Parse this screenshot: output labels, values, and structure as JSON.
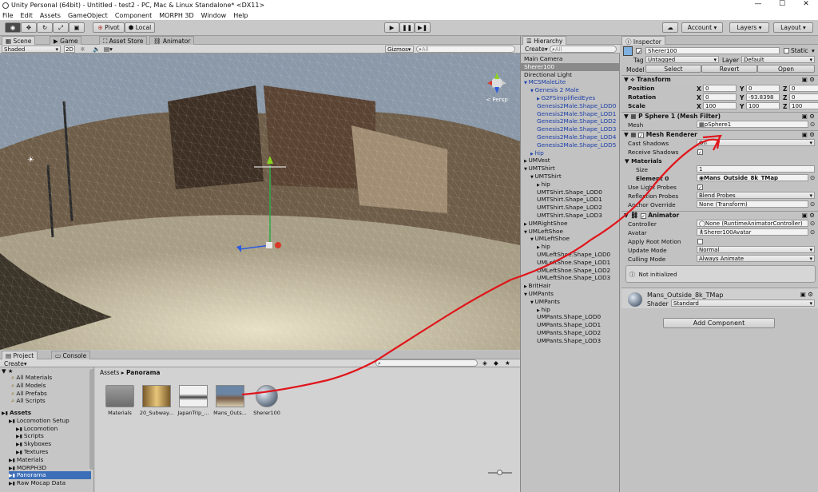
{
  "window": {
    "title": "Unity Personal (64bit) - Untitled - test2 - PC, Mac & Linux Standalone* <DX11>",
    "min": "—",
    "max": "☐",
    "close": "✕"
  },
  "menu": [
    "File",
    "Edit",
    "Assets",
    "GameObject",
    "Component",
    "MORPH 3D",
    "Window",
    "Help"
  ],
  "toolbar": {
    "pivot": "Pivot",
    "local": "Local",
    "account": "Account",
    "layers": "Layers",
    "layout": "Layout",
    "play": "▶",
    "pause": "❚❚",
    "step": "▶❚"
  },
  "scene": {
    "tabs": [
      "Scene",
      "Game",
      "Asset Store",
      "Animator"
    ],
    "shading": "Shaded",
    "mode2d": "2D",
    "gizmos": "Gizmos",
    "search_placeholder": "All",
    "persp": "< Persp"
  },
  "hierarchy": {
    "tab": "Hierarchy",
    "create": "Create",
    "search_placeholder": "All",
    "items": [
      {
        "label": "Main Camera",
        "indent": 0,
        "style": "normal",
        "arrow": ""
      },
      {
        "label": "Sherer100",
        "indent": 0,
        "style": "selected",
        "arrow": ""
      },
      {
        "label": "Directional Light",
        "indent": 0,
        "style": "normal",
        "arrow": ""
      },
      {
        "label": "MCSMaleLite",
        "indent": 0,
        "style": "blue",
        "arrow": "▼"
      },
      {
        "label": "Genesis 2 Male",
        "indent": 1,
        "style": "blue",
        "arrow": "▼"
      },
      {
        "label": "G2FSimplifiedEyes",
        "indent": 2,
        "style": "blue",
        "arrow": "▶"
      },
      {
        "label": "Genesis2Male.Shape_LOD0",
        "indent": 2,
        "style": "blue",
        "arrow": ""
      },
      {
        "label": "Genesis2Male.Shape_LOD1",
        "indent": 2,
        "style": "blue",
        "arrow": ""
      },
      {
        "label": "Genesis2Male.Shape_LOD2",
        "indent": 2,
        "style": "blue",
        "arrow": ""
      },
      {
        "label": "Genesis2Male.Shape_LOD3",
        "indent": 2,
        "style": "blue",
        "arrow": ""
      },
      {
        "label": "Genesis2Male.Shape_LOD4",
        "indent": 2,
        "style": "blue",
        "arrow": ""
      },
      {
        "label": "Genesis2Male.Shape_LOD5",
        "indent": 2,
        "style": "blue",
        "arrow": ""
      },
      {
        "label": "hip",
        "indent": 1,
        "style": "blue",
        "arrow": "▶"
      },
      {
        "label": "UMVest",
        "indent": 0,
        "style": "normal",
        "arrow": "▶"
      },
      {
        "label": "UMTShirt",
        "indent": 0,
        "style": "normal",
        "arrow": "▼"
      },
      {
        "label": "UMTShirt",
        "indent": 1,
        "style": "normal",
        "arrow": "▼"
      },
      {
        "label": "hip",
        "indent": 2,
        "style": "normal",
        "arrow": "▶"
      },
      {
        "label": "UMTShirt.Shape_LOD0",
        "indent": 2,
        "style": "normal",
        "arrow": ""
      },
      {
        "label": "UMTShirt.Shape_LOD1",
        "indent": 2,
        "style": "normal",
        "arrow": ""
      },
      {
        "label": "UMTShirt.Shape_LOD2",
        "indent": 2,
        "style": "normal",
        "arrow": ""
      },
      {
        "label": "UMTShirt.Shape_LOD3",
        "indent": 2,
        "style": "normal",
        "arrow": ""
      },
      {
        "label": "UMRightShoe",
        "indent": 0,
        "style": "normal",
        "arrow": "▶"
      },
      {
        "label": "UMLeftShoe",
        "indent": 0,
        "style": "normal",
        "arrow": "▼"
      },
      {
        "label": "UMLeftShoe",
        "indent": 1,
        "style": "normal",
        "arrow": "▼"
      },
      {
        "label": "hip",
        "indent": 2,
        "style": "normal",
        "arrow": "▶"
      },
      {
        "label": "UMLeftShoe.Shape_LOD0",
        "indent": 2,
        "style": "normal",
        "arrow": ""
      },
      {
        "label": "UMLeftShoe.Shape_LOD1",
        "indent": 2,
        "style": "normal",
        "arrow": ""
      },
      {
        "label": "UMLeftShoe.Shape_LOD2",
        "indent": 2,
        "style": "normal",
        "arrow": ""
      },
      {
        "label": "UMLeftShoe.Shape_LOD3",
        "indent": 2,
        "style": "normal",
        "arrow": ""
      },
      {
        "label": "BritHair",
        "indent": 0,
        "style": "normal",
        "arrow": "▶"
      },
      {
        "label": "UMPants",
        "indent": 0,
        "style": "normal",
        "arrow": "▼"
      },
      {
        "label": "UMPants",
        "indent": 1,
        "style": "normal",
        "arrow": "▼"
      },
      {
        "label": "hip",
        "indent": 2,
        "style": "normal",
        "arrow": "▶"
      },
      {
        "label": "UMPants.Shape_LOD0",
        "indent": 2,
        "style": "normal",
        "arrow": ""
      },
      {
        "label": "UMPants.Shape_LOD1",
        "indent": 2,
        "style": "normal",
        "arrow": ""
      },
      {
        "label": "UMPants.Shape_LOD2",
        "indent": 2,
        "style": "normal",
        "arrow": ""
      },
      {
        "label": "UMPants.Shape_LOD3",
        "indent": 2,
        "style": "normal",
        "arrow": ""
      }
    ]
  },
  "inspector": {
    "tab": "Inspector",
    "name": "Sherer100",
    "static": "Static",
    "tag_label": "Tag",
    "tag": "Untagged",
    "layer_label": "Layer",
    "layer": "Default",
    "model_label": "Model",
    "select": "Select",
    "revert": "Revert",
    "open": "Open",
    "transform": {
      "title": "Transform",
      "position": "Position",
      "rotation": "Rotation",
      "scale": "Scale",
      "pos": {
        "x": "0",
        "y": "0",
        "z": "0"
      },
      "rot": {
        "x": "0",
        "y": "-93.8398",
        "z": "0"
      },
      "scl": {
        "x": "100",
        "y": "100",
        "z": "100"
      }
    },
    "meshfilter": {
      "title": "P Sphere 1 (Mesh Filter)",
      "mesh_label": "Mesh",
      "mesh": "pSphere1"
    },
    "meshrenderer": {
      "title": "Mesh Renderer",
      "cast_shadows": "Cast Shadows",
      "cast_value": "On",
      "receive_shadows": "Receive Shadows",
      "materials": "Materials",
      "size": "Size",
      "size_value": "1",
      "element0": "Element 0",
      "element0_value": "Mans_Outside_8k_TMap",
      "light_probes": "Use Light Probes",
      "reflection_probes": "Reflection Probes",
      "reflection_value": "Blend Probes",
      "anchor_override": "Anchor Override",
      "anchor_value": "None (Transform)"
    },
    "animator": {
      "title": "Animator",
      "controller": "Controller",
      "controller_value": "None (RuntimeAnimatorController)",
      "avatar": "Avatar",
      "avatar_value": "Sherer100Avatar",
      "apply_root": "Apply Root Motion",
      "update_mode": "Update Mode",
      "update_value": "Normal",
      "culling_mode": "Culling Mode",
      "culling_value": "Always Animate",
      "info": "Not initialized"
    },
    "material": {
      "name": "Mans_Outside_8k_TMap",
      "shader_label": "Shader",
      "shader": "Standard"
    },
    "add_component": "Add Component"
  },
  "project": {
    "tabs": [
      "Project",
      "Console"
    ],
    "create": "Create",
    "breadcrumb_root": "Assets",
    "breadcrumb_current": "Panorama",
    "favorites": [
      "All Materials",
      "All Models",
      "All Prefabs",
      "All Scripts"
    ],
    "tree": [
      {
        "label": "Assets",
        "indent": 0,
        "bold": true,
        "sel": false
      },
      {
        "label": "Locomotion Setup",
        "indent": 1,
        "bold": false,
        "sel": false
      },
      {
        "label": "Locomotion",
        "indent": 2,
        "bold": false,
        "sel": false
      },
      {
        "label": "Scripts",
        "indent": 2,
        "bold": false,
        "sel": false
      },
      {
        "label": "Skyboxes",
        "indent": 2,
        "bold": false,
        "sel": false
      },
      {
        "label": "Textures",
        "indent": 2,
        "bold": false,
        "sel": false
      },
      {
        "label": "Materials",
        "indent": 1,
        "bold": false,
        "sel": false
      },
      {
        "label": "MORPH3D",
        "indent": 1,
        "bold": false,
        "sel": false
      },
      {
        "label": "Panorama",
        "indent": 1,
        "bold": false,
        "sel": true
      },
      {
        "label": "Raw Mocap Data",
        "indent": 1,
        "bold": false,
        "sel": false
      }
    ],
    "assets": [
      "Materials",
      "20_Subway...",
      "JapanTrip_...",
      "Mans_Outs...",
      "Sherer100"
    ]
  },
  "colors": {
    "annotation": "#e0151b",
    "selected": "#3d6fb8"
  }
}
